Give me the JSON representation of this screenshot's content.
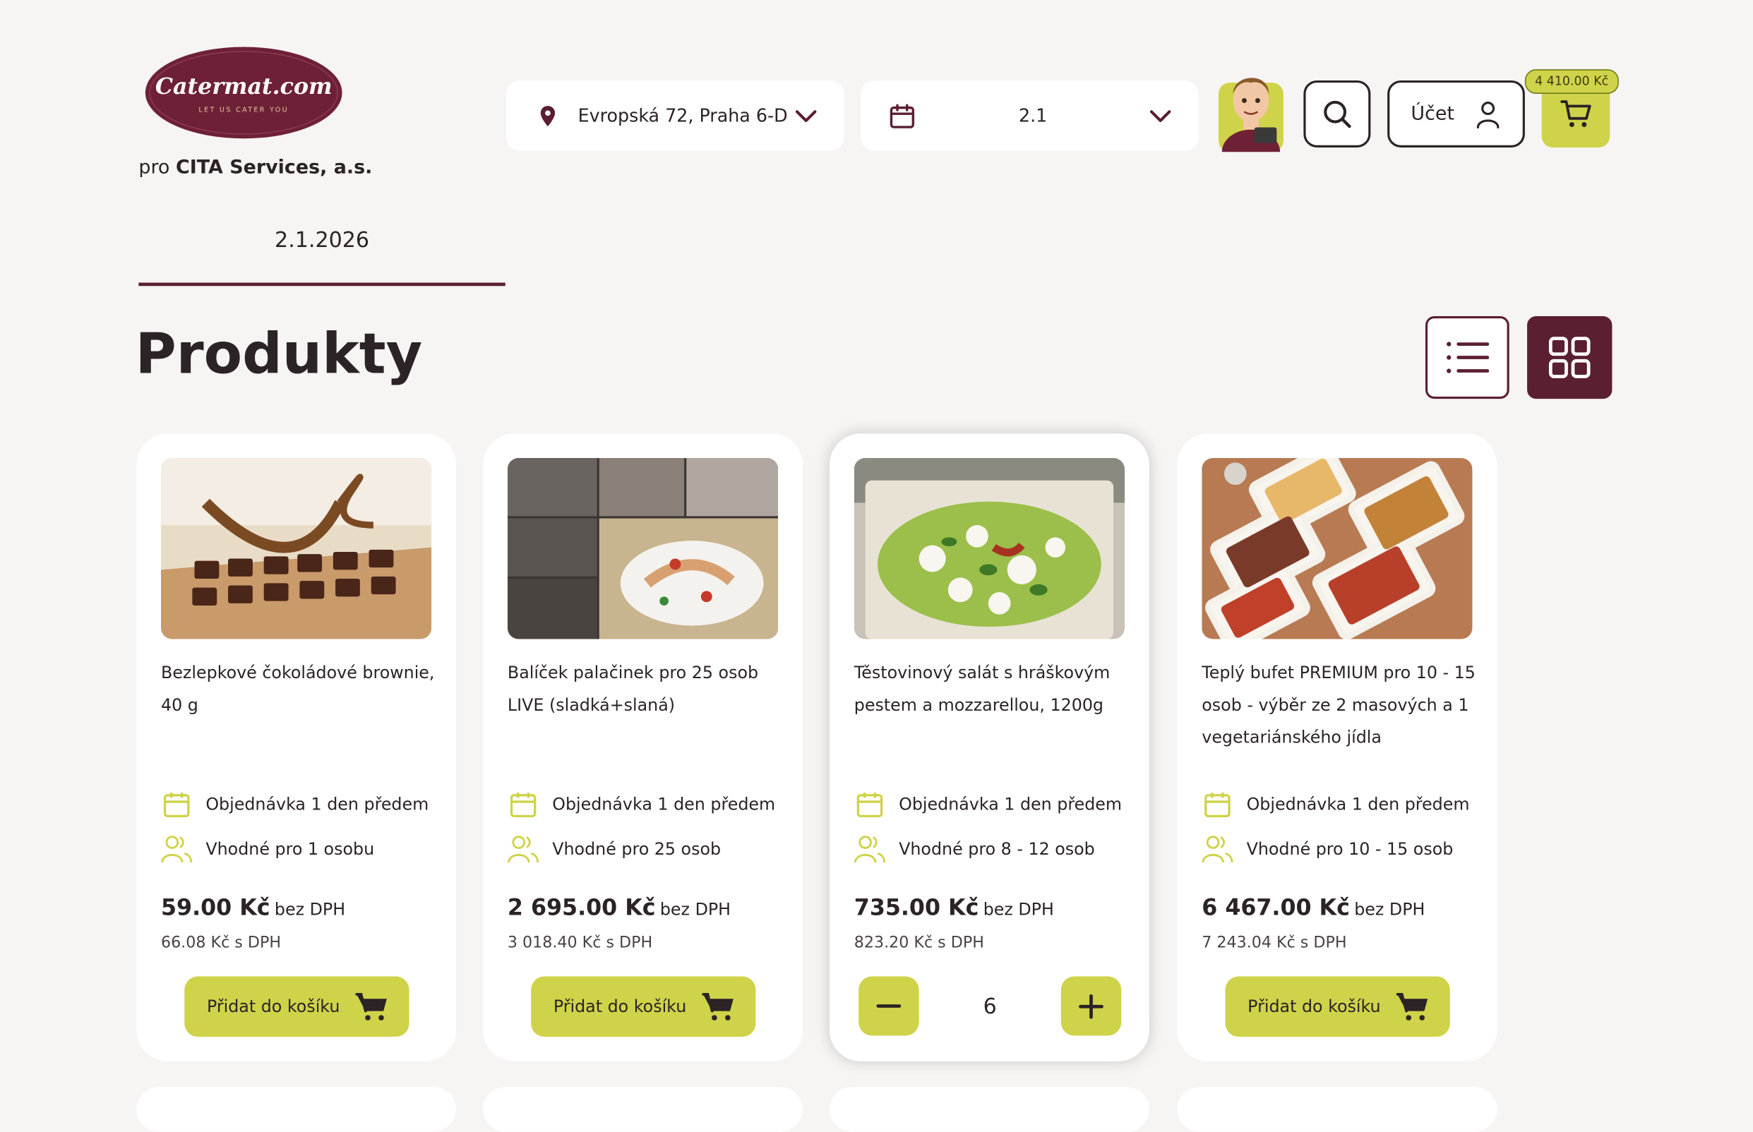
{
  "brand": {
    "logo_text": "Catermat.com",
    "logo_tagline": "LET US CATER YOU",
    "for_prefix": "pro",
    "company": "CITA Services, a.s.",
    "color_primary": "#5a1f30",
    "color_accent": "#cfd349"
  },
  "header": {
    "address": "Evropská 72, Praha 6-D",
    "date_select": "2.1",
    "account_label": "Účet",
    "cart_total": "4 410.00 Kč",
    "icons": [
      "location-pin-icon",
      "chevron-down-icon",
      "calendar-icon",
      "search-icon",
      "user-icon",
      "cart-icon"
    ]
  },
  "date_tab": {
    "label": "2.1.2026"
  },
  "page": {
    "title": "Produkty"
  },
  "products": [
    {
      "name": "Bezlepkové čokoládové brownie, 40 g",
      "order_info": "Objednávka 1 den předem",
      "people": "Vhodné pro 1 osobu",
      "price": "59.00 Kč",
      "price_suffix": "bez DPH",
      "vat_price": "66.08 Kč s DPH",
      "button": "Přidat do košíku"
    },
    {
      "name": "Balíček palačinek pro 25 osob LIVE (sladká+slaná)",
      "order_info": "Objednávka 1 den předem",
      "people": "Vhodné pro 25 osob",
      "price": "2 695.00 Kč",
      "price_suffix": "bez DPH",
      "vat_price": "3 018.40 Kč s DPH",
      "button": "Přidat do košíku"
    },
    {
      "name": "Těstovinový salát s hráškovým pestem a mozzarellou, 1200g",
      "order_info": "Objednávka 1 den předem",
      "people": "Vhodné pro 8 - 12 osob",
      "price": "735.00 Kč",
      "price_suffix": "bez DPH",
      "vat_price": "823.20 Kč s DPH",
      "quantity": "6"
    },
    {
      "name": "Teplý bufet PREMIUM pro 10 - 15 osob - výběr ze 2 masových a 1 vegetariánského jídla",
      "order_info": "Objednávka 1 den předem",
      "people": "Vhodné pro 10 - 15 osob",
      "price": "6 467.00 Kč",
      "price_suffix": "bez DPH",
      "vat_price": "7 243.04 Kč s DPH",
      "button": "Přidat do košíku"
    }
  ]
}
